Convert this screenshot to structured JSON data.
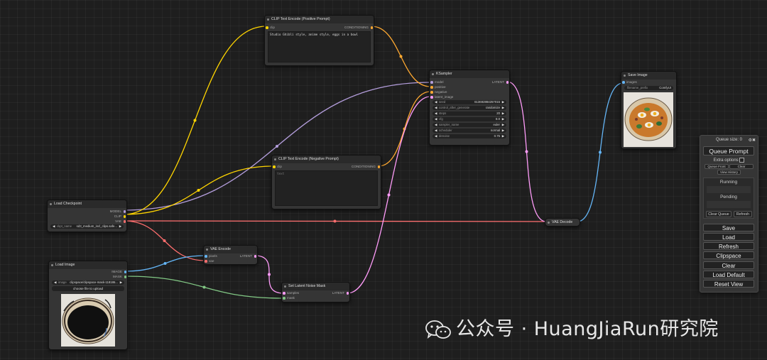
{
  "colors": {
    "canvas": "#1e1e1e",
    "node_bg": "#353535",
    "model": "#b39ddb",
    "clip": "#ffd500",
    "vae": "#ff6e6e",
    "conditioning": "#ffa931",
    "latent": "#ff9cf9",
    "image": "#64b5f6",
    "mask": "#81c784"
  },
  "nodes": {
    "clip_pos": {
      "title": "CLIP Text Encode (Positive Prompt)",
      "in_clip": "clip",
      "out_conditioning": "CONDITIONING",
      "text": "Studio Ghibli style, anime style, eggs in a bowl"
    },
    "clip_neg": {
      "title": "CLIP Text Encode (Negative Prompt)",
      "in_clip": "clip",
      "out_conditioning": "CONDITIONING",
      "text": "text"
    },
    "ksampler": {
      "title": "KSampler",
      "inputs": [
        "model",
        "positive",
        "negative",
        "latent_image"
      ],
      "out_latent": "LATENT",
      "widgets": [
        {
          "label": "seed",
          "value": "613692884257015"
        },
        {
          "label": "control_after_generate",
          "value": "randomize"
        },
        {
          "label": "steps",
          "value": "20"
        },
        {
          "label": "cfg",
          "value": "8.0"
        },
        {
          "label": "sampler_name",
          "value": "euler"
        },
        {
          "label": "scheduler",
          "value": "normal"
        },
        {
          "label": "denoise",
          "value": "0.75"
        }
      ]
    },
    "checkpoint": {
      "title": "Load Checkpoint",
      "out_model": "MODEL",
      "out_clip": "CLIP",
      "out_vae": "VAE",
      "widget_label": "ckpt_name",
      "widget_value": "sd3_medium_incl_clips.safe..."
    },
    "vae_encode": {
      "title": "VAE Encode",
      "in_pixels": "pixels",
      "in_vae": "vae",
      "out_latent": "LATENT"
    },
    "set_mask": {
      "title": "Set Latent Noise Mask",
      "in_samples": "samples",
      "in_mask": "mask",
      "out_latent": "LATENT"
    },
    "load_image": {
      "title": "Load Image",
      "out_image": "IMAGE",
      "out_mask": "MASK",
      "widget_label": "image",
      "widget_value": "clipspace/clipspace-mask-118186...",
      "upload_label": "choose file to upload"
    },
    "vae_decode": {
      "title": "VAE Decode"
    },
    "save_image": {
      "title": "Save Image",
      "in_images": "images",
      "widget_label": "filename_prefix",
      "widget_value": "ComfyUI"
    }
  },
  "queue_panel": {
    "queue_size": "Queue size: 0",
    "queue_prompt": "Queue Prompt",
    "extra_options": "Extra options",
    "queue_front": "Queue Front",
    "clear_small": "Clear",
    "view_history": "View History",
    "running": "Running",
    "pending": "Pending",
    "clear_queue": "Clear Queue",
    "refresh_small": "Refresh",
    "buttons": [
      "Save",
      "Load",
      "Refresh",
      "Clipspace",
      "Clear",
      "Load Default",
      "Reset View"
    ]
  },
  "watermark": {
    "text": "公众号 · HuangJiaRun研究院"
  }
}
